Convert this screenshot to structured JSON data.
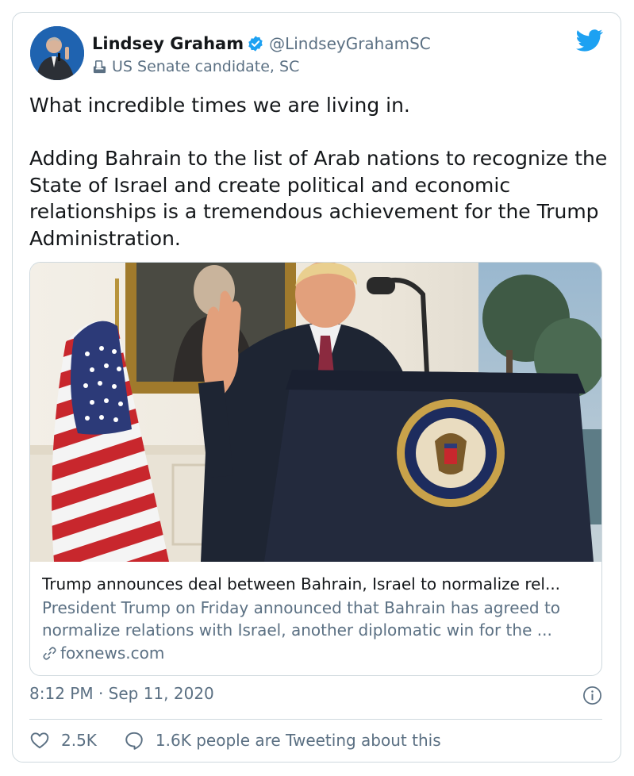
{
  "author": {
    "display_name": "Lindsey Graham",
    "handle": "@LindseyGrahamSC",
    "label": "US Senate candidate, SC",
    "verified": true,
    "avatar_icon": "avatar-photo"
  },
  "tweet": {
    "text": "What incredible times we are living in.\n\nAdding Bahrain to the list of Arab nations to recognize the State of Israel and create political and economic relationships is a tremendous achievement for the Trump Administration."
  },
  "link_card": {
    "title": "Trump announces deal between Bahrain, Israel to normalize rel...",
    "description": "President Trump on Friday announced that Bahrain has agreed to normalize relations with Israel, another diplomatic win for the ...",
    "domain": "foxnews.com",
    "image_icon": "press-conference-photo"
  },
  "meta": {
    "timestamp": "8:12 PM · Sep 11, 2020"
  },
  "actions": {
    "likes": "2.5K",
    "tweeting": "1.6K people are Tweeting about this"
  },
  "colors": {
    "accent": "#1da1f2",
    "muted": "#5b7083",
    "border": "#cfd9de"
  }
}
